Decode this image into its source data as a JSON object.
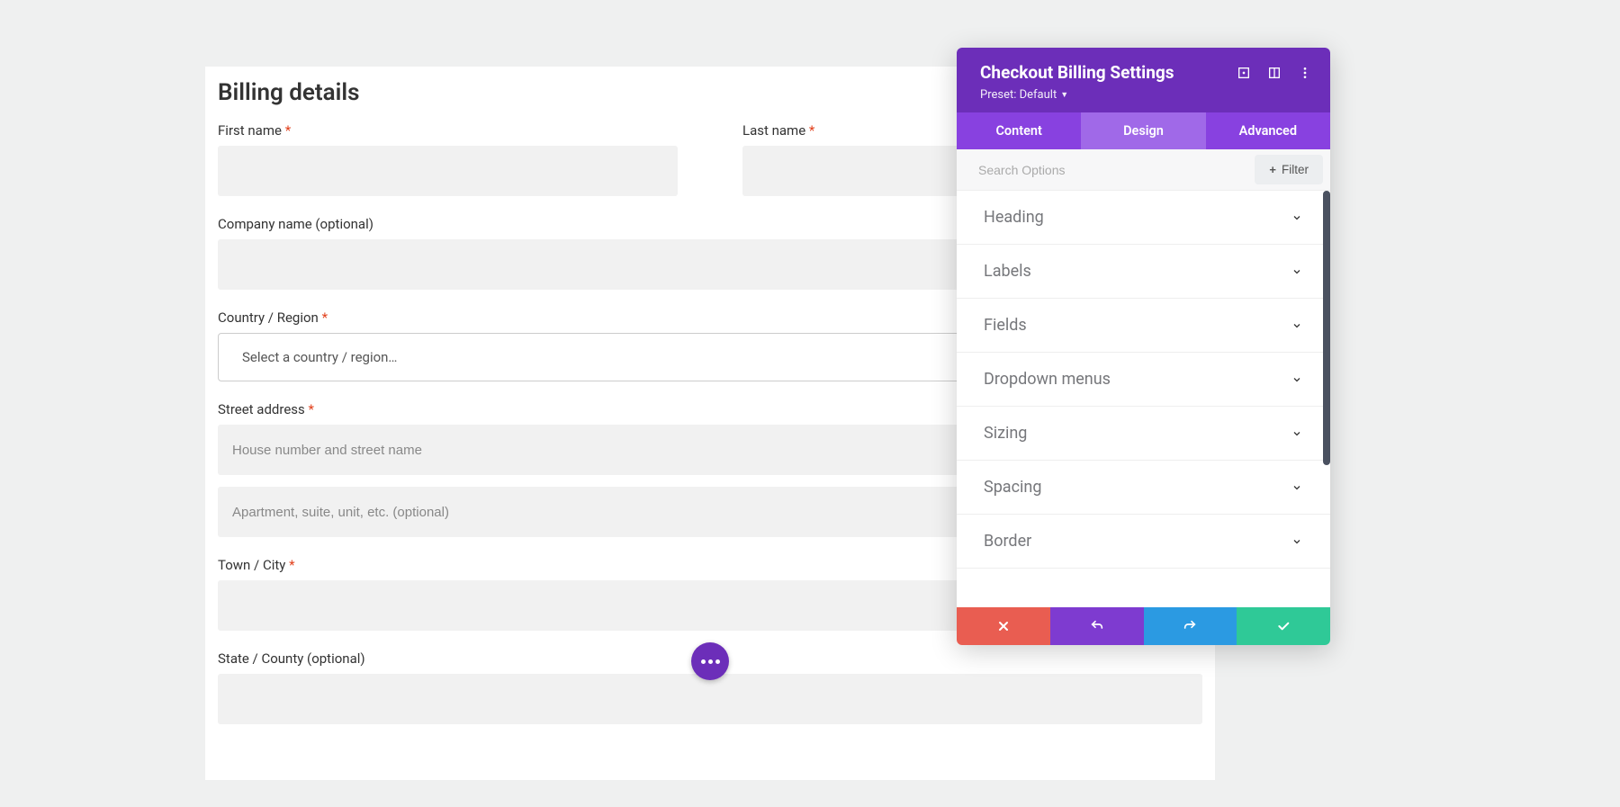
{
  "form": {
    "title": "Billing details",
    "first_name": {
      "label": "First name",
      "required": true,
      "value": ""
    },
    "last_name": {
      "label": "Last name",
      "required": true,
      "value": ""
    },
    "company": {
      "label": "Company name (optional)",
      "required": false,
      "value": ""
    },
    "country": {
      "label": "Country / Region",
      "required": true,
      "placeholder": "Select a country / region…"
    },
    "street": {
      "label": "Street address",
      "required": true,
      "placeholder1": "House number and street name",
      "placeholder2": "Apartment, suite, unit, etc. (optional)"
    },
    "city": {
      "label": "Town / City",
      "required": true,
      "value": ""
    },
    "state": {
      "label": "State / County (optional)",
      "required": false,
      "value": ""
    }
  },
  "panel": {
    "title": "Checkout Billing Settings",
    "preset_label": "Preset: Default",
    "tabs": {
      "content": "Content",
      "design": "Design",
      "advanced": "Advanced"
    },
    "active_tab": "design",
    "search_placeholder": "Search Options",
    "filter_label": "Filter",
    "sections": [
      "Heading",
      "Labels",
      "Fields",
      "Dropdown menus",
      "Sizing",
      "Spacing",
      "Border"
    ],
    "colors": {
      "header": "#6c2eb9",
      "tabbar": "#8841e0",
      "tab_active": "#a069e8",
      "cancel": "#e95d51",
      "undo": "#7e3bd0",
      "redo": "#2b9ae2",
      "save": "#2fc997"
    }
  },
  "required_marker": "*"
}
